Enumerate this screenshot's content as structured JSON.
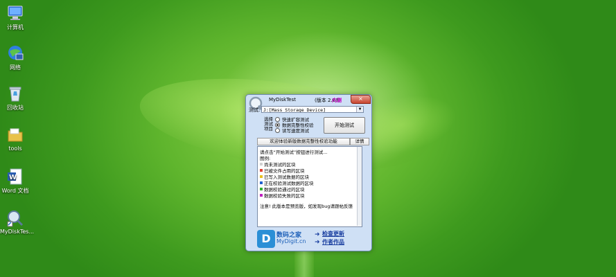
{
  "desktop": {
    "icons": [
      {
        "label": "计算机",
        "icon": "computer-icon"
      },
      {
        "label": "网络",
        "icon": "network-icon"
      },
      {
        "label": "回收站",
        "icon": "recycle-bin-icon"
      },
      {
        "label": "tools",
        "icon": "folder-icon"
      },
      {
        "label": "Word 文档",
        "icon": "word-document-icon"
      },
      {
        "label": "MyDiskTes...",
        "icon": "mydisktest-shortcut-icon"
      }
    ]
  },
  "window": {
    "title": "MyDiskTest",
    "version": "(版本 2.88)",
    "badge": "内测",
    "close_label": "×",
    "test_label": "测试:",
    "device_value": "J:[Mass Storage Device]",
    "select_group_label": "选择测试项目",
    "options": [
      {
        "label": "快速扩容测试",
        "selected": false
      },
      {
        "label": "数据完整性校验",
        "selected": true
      },
      {
        "label": "读写速度测试",
        "selected": false
      }
    ],
    "start_button": "开始测试",
    "info_header": "欢迎体验新版数据完整性校验功能",
    "detail_button": "详情",
    "info_lines": [
      {
        "text": "请点击“开始测试”按钮进行测试...",
        "color": null
      },
      {
        "text": "图例:",
        "color": null
      },
      {
        "text": "尚未测试的区块",
        "color": "#d0d0d0"
      },
      {
        "text": "已被文件占用的区块",
        "color": "#e04030"
      },
      {
        "text": "已写入测试数据的区块",
        "color": "#e8c020"
      },
      {
        "text": "正在校验测试数据的区块",
        "color": "#2060d0"
      },
      {
        "text": "数据校验通过的区块",
        "color": "#30b030"
      },
      {
        "text": "数据校验失败的区块",
        "color": "#c020c0"
      },
      {
        "text": "注意! 此版本是预览版，如发现bug请跟帖反馈",
        "color": null
      }
    ],
    "footer": {
      "brand_name": "数码之家",
      "brand_url": "MyDigit.cn",
      "check_update": "检查更新",
      "author_works": "作者作品"
    }
  }
}
